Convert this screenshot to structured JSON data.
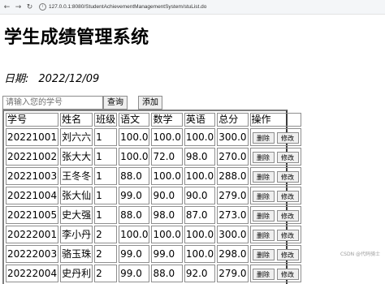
{
  "browser": {
    "url": "127.0.0.1:8080/StudentAchievementManagementSystem/stuList.do"
  },
  "page": {
    "title": "学生成绩管理系统",
    "date_label": "日期:",
    "date_value": "2022/12/09"
  },
  "search": {
    "placeholder": "请输入您的学号",
    "search_button": "查询",
    "add_button": "添加"
  },
  "table": {
    "headers": [
      "学号",
      "姓名",
      "班级",
      "语文",
      "数学",
      "英语",
      "总分",
      "操作"
    ],
    "delete_label": "删除",
    "edit_label": "修改",
    "rows": [
      [
        "20221001",
        "刘六六",
        "1",
        "100.0",
        "100.0",
        "100.0",
        "300.0"
      ],
      [
        "20221002",
        "张大大",
        "1",
        "100.0",
        "72.0",
        "98.0",
        "270.0"
      ],
      [
        "20221003",
        "王冬冬",
        "1",
        "88.0",
        "100.0",
        "100.0",
        "288.0"
      ],
      [
        "20221004",
        "张大仙",
        "1",
        "99.0",
        "90.0",
        "90.0",
        "279.0"
      ],
      [
        "20221005",
        "史大强",
        "1",
        "88.0",
        "98.0",
        "87.0",
        "273.0"
      ],
      [
        "20222001",
        "李小丹",
        "2",
        "100.0",
        "100.0",
        "100.0",
        "300.0"
      ],
      [
        "20222003",
        "骆玉珠",
        "2",
        "99.0",
        "99.0",
        "100.0",
        "298.0"
      ],
      [
        "20222004",
        "史丹利",
        "2",
        "99.0",
        "88.0",
        "92.0",
        "279.0"
      ]
    ]
  },
  "watermark": "CSDN @代码骑士"
}
